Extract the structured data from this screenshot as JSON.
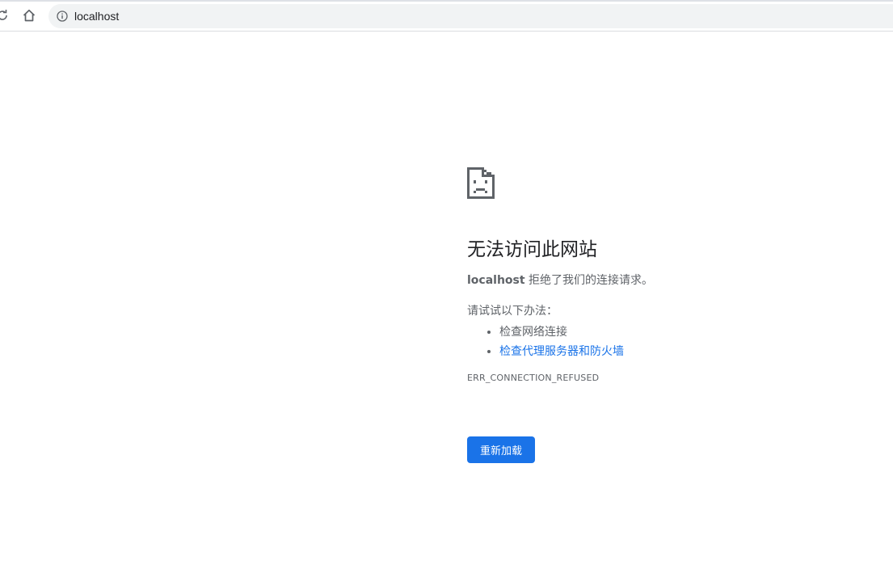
{
  "browser": {
    "url": "localhost",
    "icons": {
      "reload": "reload-icon",
      "home": "home-icon",
      "info": "info-icon"
    }
  },
  "error_page": {
    "icon": "sad-document-icon",
    "title": "无法访问此网站",
    "host": "localhost",
    "description_suffix": " 拒绝了我们的连接请求。",
    "suggestions_heading": "请试试以下办法：",
    "suggestions": [
      {
        "label": "检查网络连接",
        "is_link": false
      },
      {
        "label": "检查代理服务器和防火墙",
        "is_link": true
      }
    ],
    "error_code": "ERR_CONNECTION_REFUSED",
    "reload_button_label": "重新加载"
  },
  "colors": {
    "accent": "#1a73e8",
    "text_secondary": "#5f6368",
    "omnibox_bg": "#f1f3f4"
  }
}
